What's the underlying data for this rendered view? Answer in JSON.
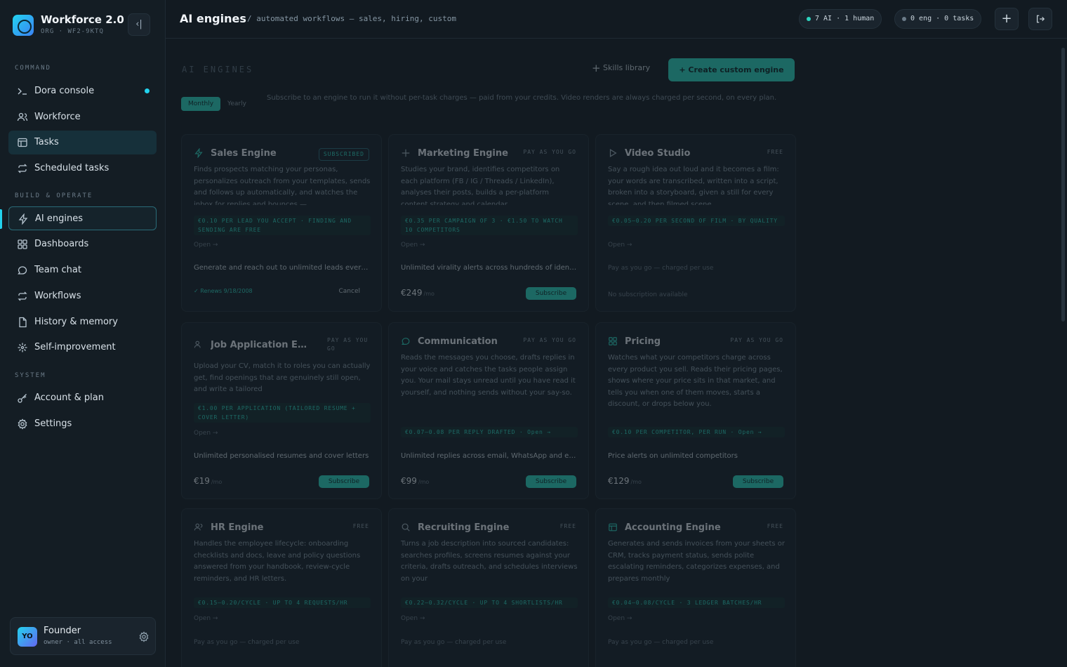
{
  "brand": {
    "title": "Workforce 2.0",
    "subtitle": "ORG · WF2-9KTQ"
  },
  "sidebar": {
    "sections": [
      {
        "label": "COMMAND"
      },
      {
        "label": "BUILD & OPERATE"
      },
      {
        "label": "SYSTEM"
      }
    ],
    "items": [
      {
        "label": "Dora console",
        "icon": "terminal-icon"
      },
      {
        "label": "Workforce",
        "icon": "users-icon"
      },
      {
        "label": "Tasks",
        "icon": "table-icon"
      },
      {
        "label": "Scheduled tasks",
        "icon": "repeat-icon"
      },
      {
        "label": "AI engines",
        "icon": "bolt-icon"
      },
      {
        "label": "Dashboards",
        "icon": "grid-icon"
      },
      {
        "label": "Team chat",
        "icon": "chat-icon"
      },
      {
        "label": "Workflows",
        "icon": "repeat-icon"
      },
      {
        "label": "History & memory",
        "icon": "document-icon"
      },
      {
        "label": "Self-improvement",
        "icon": "sparkle-icon"
      },
      {
        "label": "Account & plan",
        "icon": "key-icon"
      },
      {
        "label": "Settings",
        "icon": "gear-icon"
      }
    ]
  },
  "user": {
    "initials": "YO",
    "name": "Founder",
    "role": "owner · all access"
  },
  "header": {
    "title": "AI engines",
    "crumb": "/ automated workflows — sales, hiring, custom",
    "status_ai": "7 AI · 1 human",
    "status_eng": "0 eng · 0 tasks"
  },
  "main": {
    "label": "AI ENGINES",
    "skills_label": "Skills library",
    "create_label": "+ Create custom engine",
    "billing_toggle": [
      "Monthly",
      "Yearly"
    ],
    "info": "Subscribe to an engine to run it without per-task charges — paid from your credits. Video renders are always charged per second, on every plan."
  },
  "cards": [
    {
      "title": "Sales Engine",
      "badge": "SUBSCRIBED",
      "desc": "Finds prospects matching your personas, personalizes outreach from your templates, sends and follows up automatically, and watches the inbox for replies and bounces —",
      "price": "€0.10 PER LEAD YOU ACCEPT · FINDING AND SENDING ARE FREE",
      "open": "Open →",
      "feature": "Generate and reach out to unlimited leads every month",
      "renews": "✓ Renews 9/18/2008",
      "cancel": "Cancel"
    },
    {
      "title": "Marketing Engine",
      "badge": "PAY AS YOU GO",
      "desc": "Studies your brand, identifies competitors on each platform (FB / IG / Threads / LinkedIn), analyses their posts, builds a per-platform content strategy and calendar",
      "price": "€0.35 PER CAMPAIGN OF 3 · €1.50 TO WATCH 10 COMPETITORS",
      "open": "Open →",
      "feature": "Unlimited virality alerts across hundreds of identified competitors",
      "amount": "€249",
      "per": "/mo",
      "subscribe": "Subscribe"
    },
    {
      "title": "Video Studio",
      "badge": "FREE",
      "desc": "Say a rough idea out loud and it becomes a film: your words are transcribed, written into a script, broken into a storyboard, given a still for every scene, and then filmed scene",
      "price": "€0.05–0.20 PER SECOND OF FILM · BY QUALITY",
      "open": "Open →",
      "muted1": "Pay as you go — charged per use",
      "muted2": "No subscription available"
    },
    {
      "title": "Job Application En...",
      "badge": "PAY AS YOU GO",
      "desc": "Upload your CV, match it to roles you can actually get, find openings that are genuinely still open, and write a tailored",
      "price": "€1.00 PER APPLICATION (TAILORED RESUME + COVER LETTER)",
      "open": "Open →",
      "feature": "Unlimited personalised resumes and cover letters",
      "amount": "€19",
      "per": "/mo",
      "subscribe": "Subscribe"
    },
    {
      "title": "Communication",
      "badge": "PAY AS YOU GO",
      "desc": "Reads the messages you choose, drafts replies in your voice and catches the tasks people assign you. Your mail stays unread until you have read it yourself, and nothing sends without your say-so.",
      "price": "€0.07–0.08 PER REPLY DRAFTED · Open →",
      "feature": "Unlimited replies across email, WhatsApp and every channel",
      "amount": "€99",
      "per": "/mo",
      "subscribe": "Subscribe"
    },
    {
      "title": "Pricing",
      "badge": "PAY AS YOU GO",
      "desc": "Watches what your competitors charge across every product you sell. Reads their pricing pages, shows where your price sits in that market, and tells you when one of them moves, starts a discount, or drops below you.",
      "price": "€0.10 PER COMPETITOR, PER RUN · Open →",
      "feature": "Price alerts on unlimited competitors",
      "amount": "€129",
      "per": "/mo",
      "subscribe": "Subscribe"
    },
    {
      "title": "HR Engine",
      "badge": "FREE",
      "desc": "Handles the employee lifecycle: onboarding checklists and docs, leave and policy questions answered from your handbook, review-cycle reminders, and HR letters.",
      "price": "€0.15–0.20/CYCLE · UP TO 4 REQUESTS/HR",
      "open": "Open →",
      "muted1": "Pay as you go — charged per use"
    },
    {
      "title": "Recruiting Engine",
      "badge": "FREE",
      "desc": "Turns a job description into sourced candidates: searches profiles, screens resumes against your criteria, drafts outreach, and schedules interviews on your",
      "price": "€0.22–0.32/CYCLE · UP TO 4 SHORTLISTS/HR",
      "open": "Open →",
      "muted1": "Pay as you go — charged per use"
    },
    {
      "title": "Accounting Engine",
      "badge": "FREE",
      "desc": "Generates and sends invoices from your sheets or CRM, tracks payment status, sends polite escalating reminders, categorizes expenses, and prepares monthly",
      "price": "€0.04–0.08/CYCLE · 3 LEDGER BATCHES/HR",
      "open": "Open →",
      "muted1": "Pay as you go — charged per use"
    }
  ]
}
